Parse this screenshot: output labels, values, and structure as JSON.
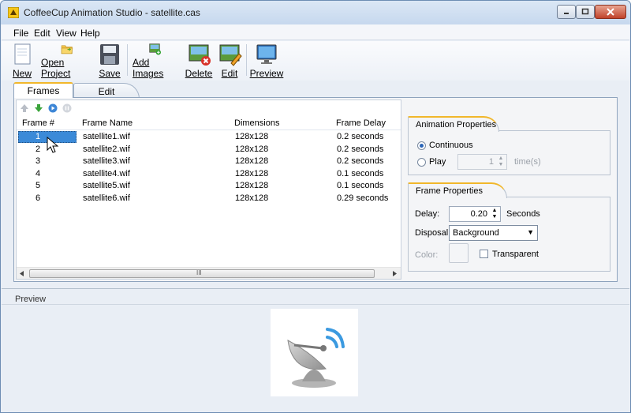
{
  "window": {
    "title": "CoffeeCup Animation Studio - satellite.cas"
  },
  "menu": [
    "File",
    "Edit",
    "View",
    "Help"
  ],
  "toolbar": {
    "new": "New",
    "open": "Open Project",
    "save": "Save",
    "add_images": "Add Images",
    "delete": "Delete",
    "edit": "Edit",
    "preview": "Preview"
  },
  "tabs": {
    "frames": "Frames",
    "edit": "Edit"
  },
  "frames_table": {
    "columns": [
      "Frame #",
      "Frame Name",
      "Dimensions",
      "Frame Delay"
    ],
    "rows": [
      {
        "num": "1",
        "name": "satellite1.wif",
        "dim": "128x128",
        "delay": "0.2 seconds"
      },
      {
        "num": "2",
        "name": "satellite2.wif",
        "dim": "128x128",
        "delay": "0.2 seconds"
      },
      {
        "num": "3",
        "name": "satellite3.wif",
        "dim": "128x128",
        "delay": "0.2 seconds"
      },
      {
        "num": "4",
        "name": "satellite4.wif",
        "dim": "128x128",
        "delay": "0.1 seconds"
      },
      {
        "num": "5",
        "name": "satellite5.wif",
        "dim": "128x128",
        "delay": "0.1 seconds"
      },
      {
        "num": "6",
        "name": "satellite6.wif",
        "dim": "128x128",
        "delay": "0.29 seconds"
      }
    ],
    "selected_row": "1",
    "scroll_grip": "III"
  },
  "animation_properties": {
    "title": "Animation Properties",
    "continuous_label": "Continuous",
    "play_label": "Play",
    "play_count": "1",
    "times_label": "time(s)",
    "mode": "Continuous"
  },
  "frame_properties": {
    "title": "Frame Properties",
    "delay_label": "Delay:",
    "delay_value": "0.20",
    "seconds_label": "Seconds",
    "disposal_label": "Disposal:",
    "disposal_value": "Background",
    "color_label": "Color:",
    "transparent_label": "Transparent"
  },
  "preview": {
    "label": "Preview"
  },
  "colors": {
    "accent_tab": "#f1b72b",
    "selection": "#3b8ad8"
  }
}
